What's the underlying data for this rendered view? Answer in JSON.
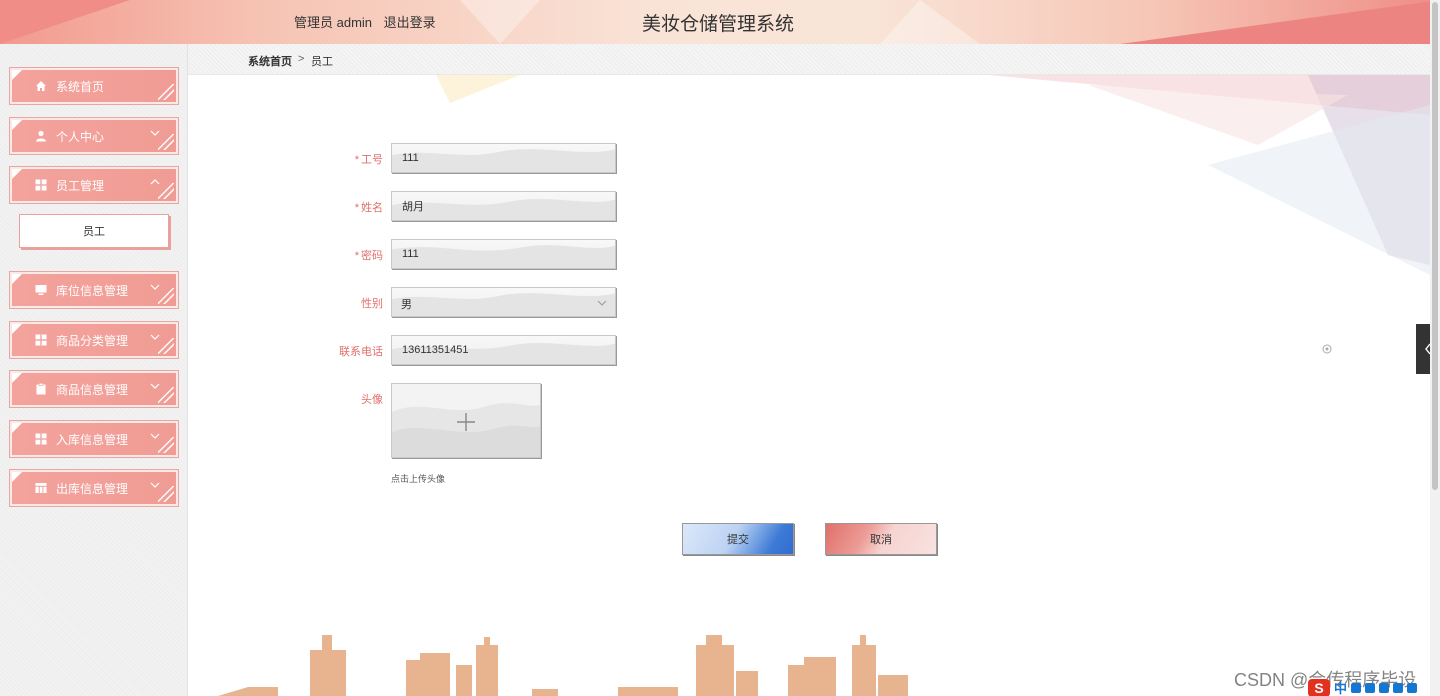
{
  "header": {
    "admin_text": "管理员 admin",
    "logout_label": "退出登录",
    "title": "美妆仓储管理系统"
  },
  "sidebar": {
    "items": [
      {
        "label": "系统首页",
        "icon": "home-icon",
        "has_chevron": false
      },
      {
        "label": "个人中心",
        "icon": "user-icon",
        "chevron": "down"
      },
      {
        "label": "员工管理",
        "icon": "grid-icon",
        "chevron": "up"
      },
      {
        "label": "库位信息管理",
        "icon": "monitor-icon",
        "chevron": "down"
      },
      {
        "label": "商品分类管理",
        "icon": "grid-icon",
        "chevron": "down"
      },
      {
        "label": "商品信息管理",
        "icon": "clipboard-icon",
        "chevron": "down"
      },
      {
        "label": "入库信息管理",
        "icon": "grid-icon",
        "chevron": "down"
      },
      {
        "label": "出库信息管理",
        "icon": "table-icon",
        "chevron": "down"
      }
    ],
    "sub_item": "员工"
  },
  "breadcrumb": {
    "home": "系统首页",
    "separator": ">",
    "current": "员工"
  },
  "form": {
    "fields": {
      "employee_no": {
        "label": "工号",
        "required": true,
        "value": "111"
      },
      "name": {
        "label": "姓名",
        "required": true,
        "value": "胡月"
      },
      "password": {
        "label": "密码",
        "required": true,
        "value": "111"
      },
      "gender": {
        "label": "性别",
        "required": false,
        "value": "男"
      },
      "phone": {
        "label": "联系电话",
        "required": false,
        "value": "13611351451"
      },
      "avatar": {
        "label": "头像",
        "required": false
      }
    },
    "upload_tip": "点击上传头像",
    "submit_label": "提交",
    "cancel_label": "取消"
  },
  "watermark": "CSDN @会传程序毕设",
  "ime": {
    "logo": "S",
    "lang": "中"
  },
  "colors": {
    "accent": "#f09c95",
    "label_red": "#e0706b",
    "submit_blue": "#2f6cd0"
  }
}
